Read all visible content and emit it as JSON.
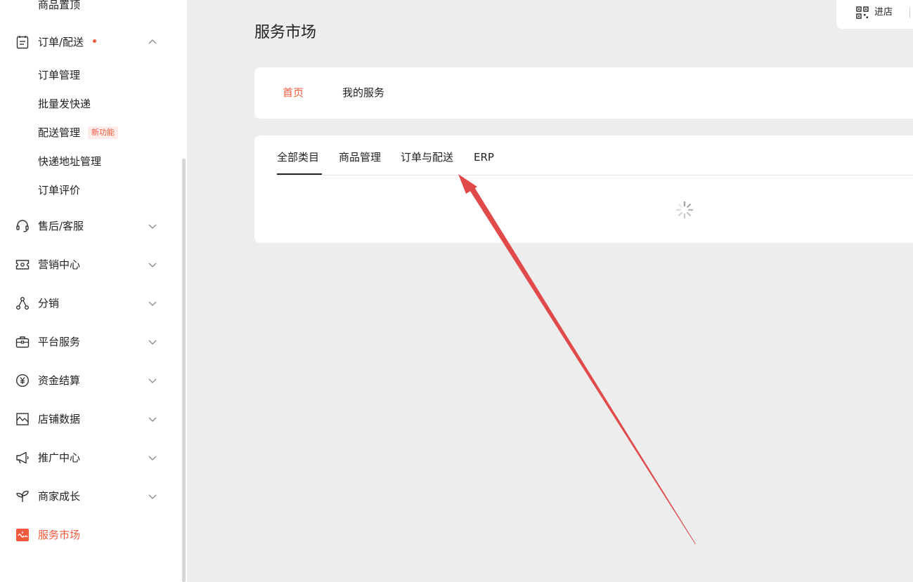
{
  "sidebar": {
    "partial_top_item": "商品置顶",
    "order_group": {
      "label": "订单/配送",
      "items": [
        "订单管理",
        "批量发快递",
        "配送管理",
        "快递地址管理",
        "订单评价"
      ],
      "new_badge": "新功能"
    },
    "menu": [
      {
        "label": "售后/客服",
        "icon": "headset-icon"
      },
      {
        "label": "营销中心",
        "icon": "ticket-icon"
      },
      {
        "label": "分销",
        "icon": "share-nodes-icon"
      },
      {
        "label": "平台服务",
        "icon": "briefcase-icon"
      },
      {
        "label": "资金结算",
        "icon": "yen-circle-icon"
      },
      {
        "label": "店铺数据",
        "icon": "chart-box-icon"
      },
      {
        "label": "推广中心",
        "icon": "megaphone-icon"
      },
      {
        "label": "商家成长",
        "icon": "sprout-icon"
      },
      {
        "label": "服务市场",
        "icon": "puzzle-icon"
      }
    ]
  },
  "top_right": {
    "enter_store": "进店"
  },
  "page": {
    "title": "服务市场",
    "top_tabs": [
      "首页",
      "我的服务"
    ],
    "category_tabs": [
      "全部类目",
      "商品管理",
      "订单与配送",
      "ERP"
    ]
  },
  "colors": {
    "accent": "#f05a3c",
    "annotation_arrow": "#e04a4a"
  }
}
